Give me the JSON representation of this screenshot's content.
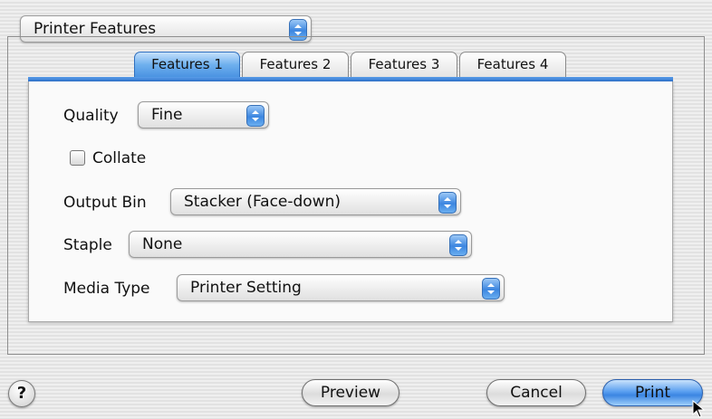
{
  "panel_menu": {
    "selected": "Printer Features"
  },
  "tabs": [
    {
      "label": "Features 1",
      "active": true
    },
    {
      "label": "Features 2",
      "active": false
    },
    {
      "label": "Features 3",
      "active": false
    },
    {
      "label": "Features 4",
      "active": false
    }
  ],
  "fields": {
    "quality": {
      "label": "Quality",
      "value": "Fine"
    },
    "collate": {
      "label": "Collate",
      "checked": false
    },
    "output_bin": {
      "label": "Output Bin",
      "value": "Stacker (Face-down)"
    },
    "staple": {
      "label": "Staple",
      "value": "None"
    },
    "media_type": {
      "label": "Media Type",
      "value": "Printer Setting"
    }
  },
  "buttons": {
    "help": "?",
    "preview": "Preview",
    "cancel": "Cancel",
    "print": "Print"
  },
  "colors": {
    "accent_blue": "#3c86e0",
    "background": "#ececec"
  },
  "icons": {
    "popup_arrows": "up-down-arrows-icon",
    "cursor": "mouse-pointer-icon"
  }
}
